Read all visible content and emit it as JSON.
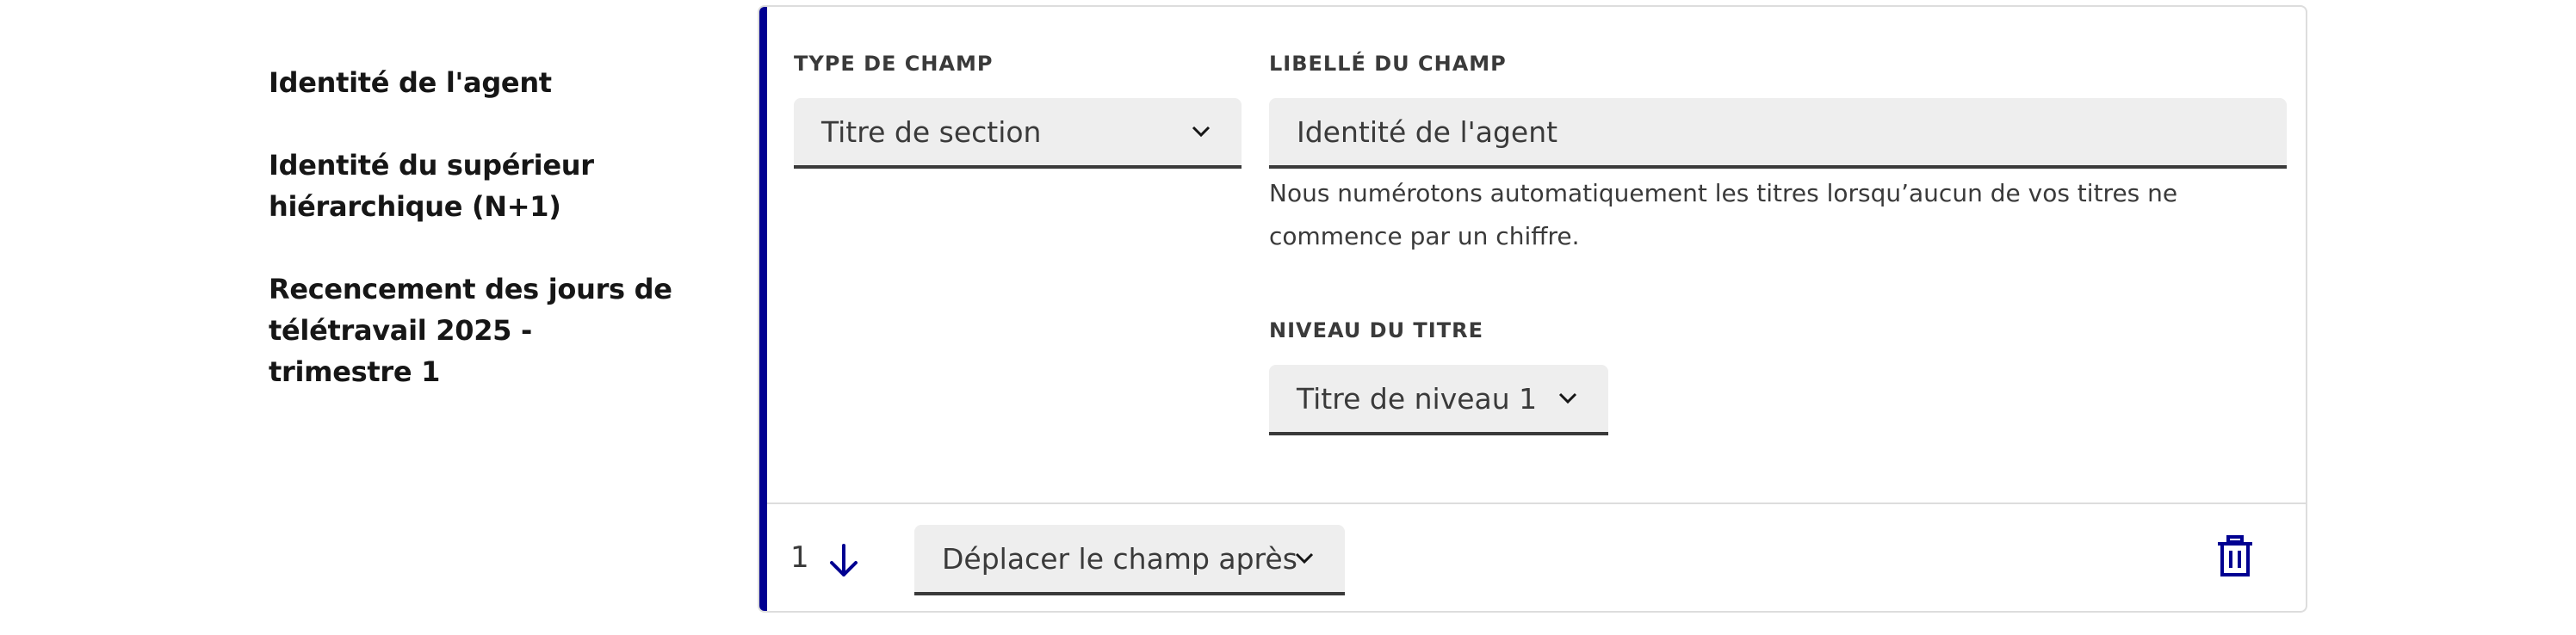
{
  "sidebar": {
    "items": [
      {
        "label": "Identité de l'agent"
      },
      {
        "label": "Identité du supérieur hiérarchique (N+1)"
      },
      {
        "label": "Recencement des jours de télétravail 2025 - trimestre 1"
      }
    ]
  },
  "field_card": {
    "type_label": "TYPE DE CHAMP",
    "type_value": "Titre de section",
    "libelle_label": "LIBELLÉ DU CHAMP",
    "libelle_value": "Identité de l'agent",
    "hint": "Nous numérotons automatiquement les titres lorsqu’aucun de vos titres ne commence par un chiffre.",
    "niveau_label": "NIVEAU DU TITRE",
    "niveau_value": "Titre de niveau 1",
    "position": "1",
    "move_value": "Déplacer le champ après"
  },
  "colors": {
    "accent": "#000091",
    "input_bg": "#eeeeee",
    "border": "#dddddd"
  },
  "icons": [
    "chevron-down-icon",
    "arrow-down-icon",
    "trash-icon"
  ]
}
